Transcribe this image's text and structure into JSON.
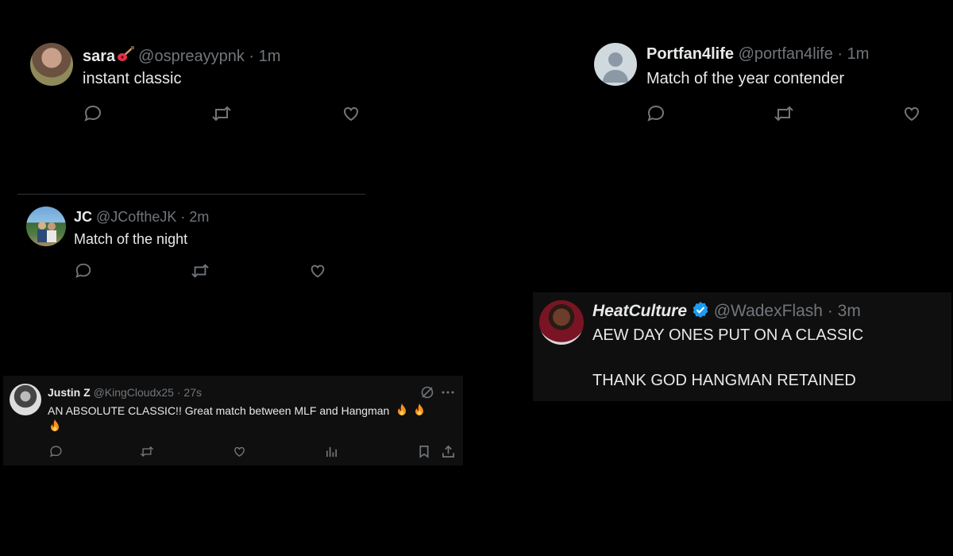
{
  "colors": {
    "background": "#000000",
    "text": "#e7e9ea",
    "muted": "#71767b",
    "verified": "#1d9bf0",
    "panel": "#0f0f0f"
  },
  "tweets": [
    {
      "name": "sara",
      "name_emoji": "guitar-icon",
      "handle": "@ospreayypnk",
      "sep": "·",
      "time": "1m",
      "text": "instant classic"
    },
    {
      "name": "Portfan4life",
      "handle": "@portfan4life",
      "sep": "·",
      "time": "1m",
      "text": "Match of the year contender"
    },
    {
      "name": "JC",
      "handle": "@JCoftheJK",
      "sep": "·",
      "time": "2m",
      "text": "Match of the night"
    },
    {
      "name": "HeatCulture",
      "verified": true,
      "handle": "@WadexFlash",
      "sep": "·",
      "time": "3m",
      "text": "AEW DAY ONES PUT ON A CLASSIC",
      "text2": "THANK GOD HANGMAN RETAINED"
    },
    {
      "name": "Justin Z",
      "handle": "@KingCloudx25",
      "sep": "·",
      "time": "27s",
      "text": "AN ABSOLUTE CLASSIC!! Great match between MLF and Hangman",
      "emoji": "fire-icon"
    }
  ],
  "icons": [
    "reply-icon",
    "retweet-icon",
    "like-icon",
    "views-icon",
    "bookmark-icon",
    "share-icon",
    "grok-icon",
    "more-icon",
    "verified-icon"
  ]
}
